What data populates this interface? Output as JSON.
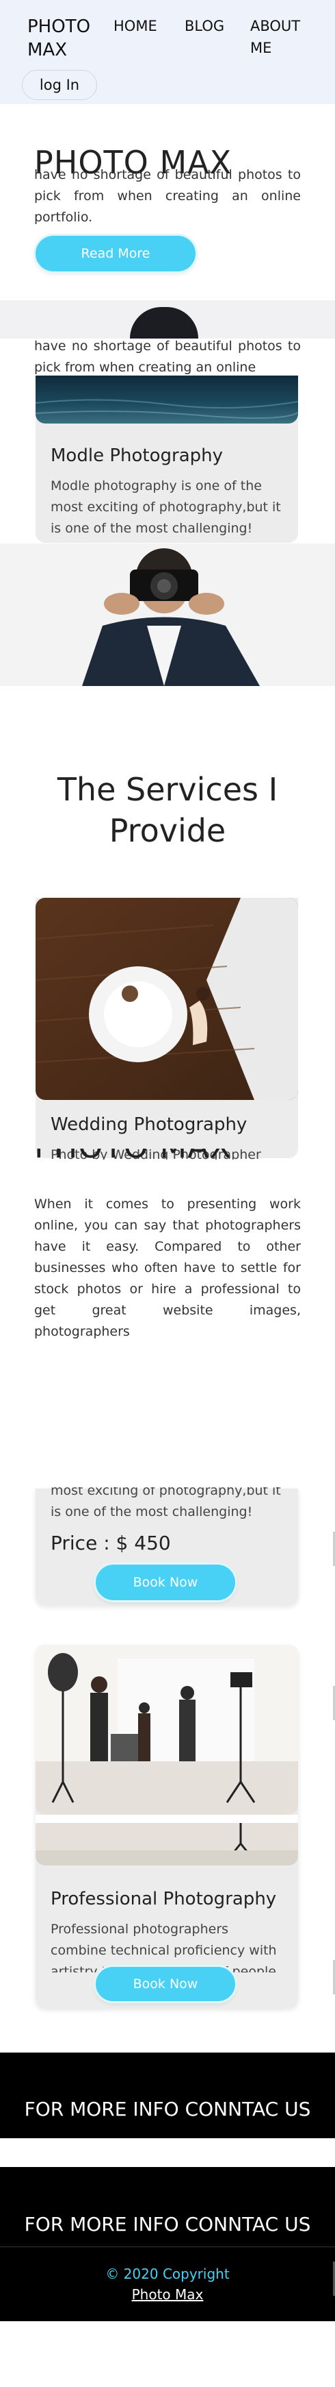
{
  "header": {
    "logo": "PHOTO MAX",
    "nav": [
      "HOME",
      "BLOG",
      "ABOUT ME"
    ],
    "login": "log In"
  },
  "hero": {
    "title": "PHOTO MAX",
    "text": "have no shortage of beautiful photos to pick from when creating an online portfolio.",
    "button": "Read More"
  },
  "strip": {
    "text": "have no shortage of beautiful photos to pick from when creating an online"
  },
  "model_card": {
    "title": "Modle Photography",
    "text": "Modle photography is one of the most exciting of photography,but it is one of the most challenging!"
  },
  "services": {
    "title": "The Services I Provide",
    "wedding": {
      "title": "Wedding Photography",
      "text": "Photo by Wedding Photographer"
    },
    "overlay_title": "PHOTO MAX",
    "overlay_text": "When it comes to presenting work online, you can say that photographers have it easy. Compared to other businesses who often have to settle for stock photos or hire a professional to get great website images, photographers",
    "price_card": {
      "text_tail": "most exciting of photography,but it is one of the most challenging!",
      "price": "Price : $ 450",
      "button": "Book Now"
    },
    "professional": {
      "title": "Professional Photography",
      "text": "Professional photographers combine technical proficiency with artistry to create images of people",
      "button": "Book Now"
    }
  },
  "footer": {
    "info1": "FOR MORE INFO CONNTAC US",
    "info2": "FOR MORE INFO CONNTAC US",
    "copyright": "© 2020 Copyright",
    "copyright_link": "Photo Max"
  },
  "colors": {
    "accent": "#49d1f5",
    "header_bg": "#eef3fb",
    "card_bg": "#ececec",
    "footer_bg": "#000000",
    "copyright": "#49d1f5"
  }
}
